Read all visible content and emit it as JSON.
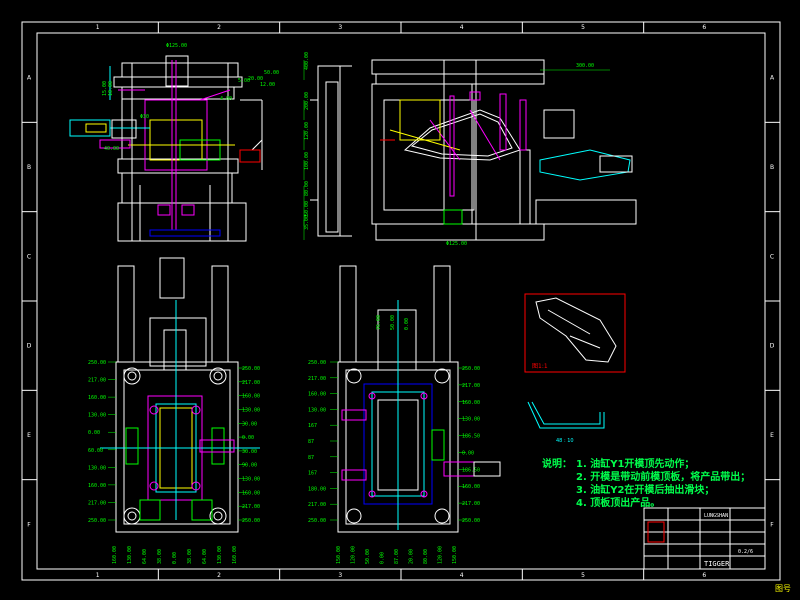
{
  "border": {
    "columns": [
      "1",
      "2",
      "3",
      "4",
      "5",
      "6"
    ],
    "rows": [
      "A",
      "B",
      "C",
      "D",
      "E",
      "F"
    ]
  },
  "notes": {
    "heading": "说明：",
    "items": [
      "1. 油缸Y1开模顶先动作；",
      "2. 开模是带动前模顶板，将产品带出；",
      "3. 油缸Y2在开模后抽出滑块；",
      "4. 顶板顶出产品。"
    ]
  },
  "inset": {
    "label": "图1:1",
    "sub_label": "48 : 10"
  },
  "title_block": {
    "company": "LUNGSHAN",
    "logo": "TIGGER",
    "sheet": "0.2/6"
  },
  "sheet_number": "图号",
  "dims": {
    "top_left": [
      "Φ125.00",
      "15.00",
      "10.00",
      "5.00",
      "12.00",
      "20.00",
      "50.00",
      "40.00",
      "Φ30",
      "4.00"
    ],
    "top_mid": [
      "400.00",
      "200.00",
      "120.00",
      "100.00",
      "80.00",
      "50.00",
      "35.00"
    ],
    "top_right": [
      "300.00",
      "Φ125.00"
    ],
    "bl_left": [
      "250.00",
      "217.00",
      "160.00",
      "130.00",
      "0.00",
      "60.00",
      "130.00",
      "160.00",
      "217.00",
      "250.00"
    ],
    "bl_right": [
      "250.00",
      "217.00",
      "160.00",
      "130.00",
      "30.00",
      "0.00",
      "30.00",
      "90.00",
      "130.00",
      "160.00",
      "217.00",
      "250.00"
    ],
    "bl_bottom": [
      "160.00",
      "130.00",
      "64.00",
      "38.00",
      "0.00",
      "38.00",
      "64.00",
      "130.00",
      "160.00"
    ],
    "br_left": [
      "250.00",
      "217.00",
      "160.00",
      "130.00",
      "167",
      "87",
      "87",
      "167",
      "180.00",
      "217.00",
      "250.00"
    ],
    "br_right": [
      "250.00",
      "217.00",
      "160.00",
      "130.00",
      "186.50",
      "0.00",
      "186.50",
      "160.00",
      "217.00",
      "250.00"
    ],
    "br_bottom": [
      "150.00",
      "120.00",
      "50.00",
      "0.00",
      "87.00",
      "20.00",
      "80.00",
      "120.00",
      "150.00"
    ],
    "br_top": [
      "76.00",
      "50.00",
      "0.00"
    ]
  }
}
